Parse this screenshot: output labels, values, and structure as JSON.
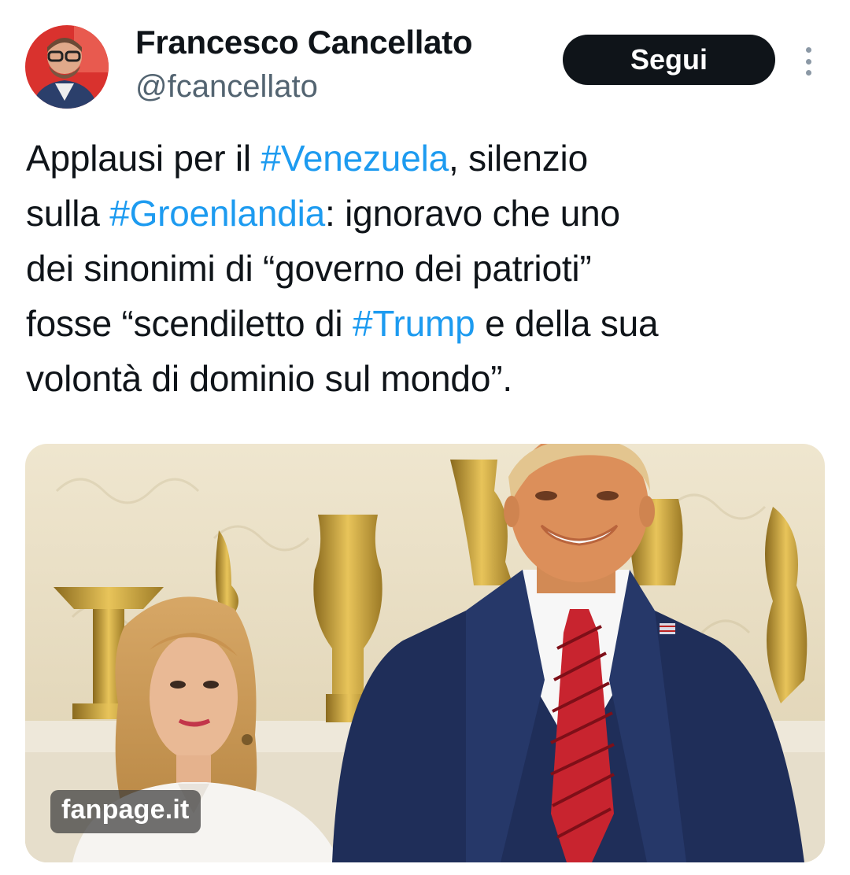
{
  "tweet": {
    "author": {
      "name": "Francesco Cancellato",
      "handle": "@fcancellato"
    },
    "follow_label": "Segui",
    "text_lines": [
      [
        {
          "t": "Applausi per il "
        },
        {
          "t": "#Venezuela",
          "tag": true
        },
        {
          "t": ", silenzio"
        }
      ],
      [
        {
          "t": "sulla "
        },
        {
          "t": "#Groenlandia",
          "tag": true
        },
        {
          "t": ": ignoravo che uno"
        }
      ],
      [
        {
          "t": "dei sinonimi di “governo dei patrioti”"
        }
      ],
      [
        {
          "t": "fosse “scendiletto di "
        },
        {
          "t": "#Trump",
          "tag": true
        },
        {
          "t": " e della sua"
        }
      ],
      [
        {
          "t": "volontà di dominio sul mondo”."
        }
      ]
    ],
    "media": {
      "watermark": "fanpage.it"
    }
  },
  "colors": {
    "text": "#0f1419",
    "secondary": "#536471",
    "hashtag": "#1d9bf0",
    "button_bg": "#0f1419",
    "button_text": "#ffffff"
  },
  "icons": {
    "more": "more-vertical-icon"
  }
}
